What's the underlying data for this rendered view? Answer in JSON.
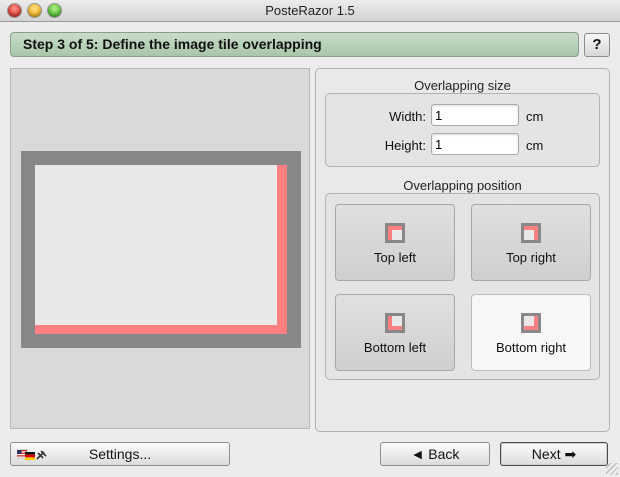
{
  "window": {
    "title": "PosteRazor 1.5"
  },
  "step": {
    "text": "Step 3 of 5: Define the image tile overlapping",
    "help_label": "?"
  },
  "overlapping_size": {
    "title": "Overlapping size",
    "width": {
      "label": "Width:",
      "value": "1",
      "unit": "cm"
    },
    "height": {
      "label": "Height:",
      "value": "1",
      "unit": "cm"
    }
  },
  "overlapping_position": {
    "title": "Overlapping position",
    "options": [
      {
        "label": "Top left",
        "selected": false
      },
      {
        "label": "Top right",
        "selected": false
      },
      {
        "label": "Bottom left",
        "selected": false
      },
      {
        "label": "Bottom right",
        "selected": true
      }
    ]
  },
  "footer": {
    "settings_label": "Settings...",
    "back_label": "◄ Back",
    "next_label": "Next ➡"
  },
  "colors": {
    "overlap": "#ff8080",
    "frame": "#888888",
    "step_bar": "#b5cfb5"
  }
}
